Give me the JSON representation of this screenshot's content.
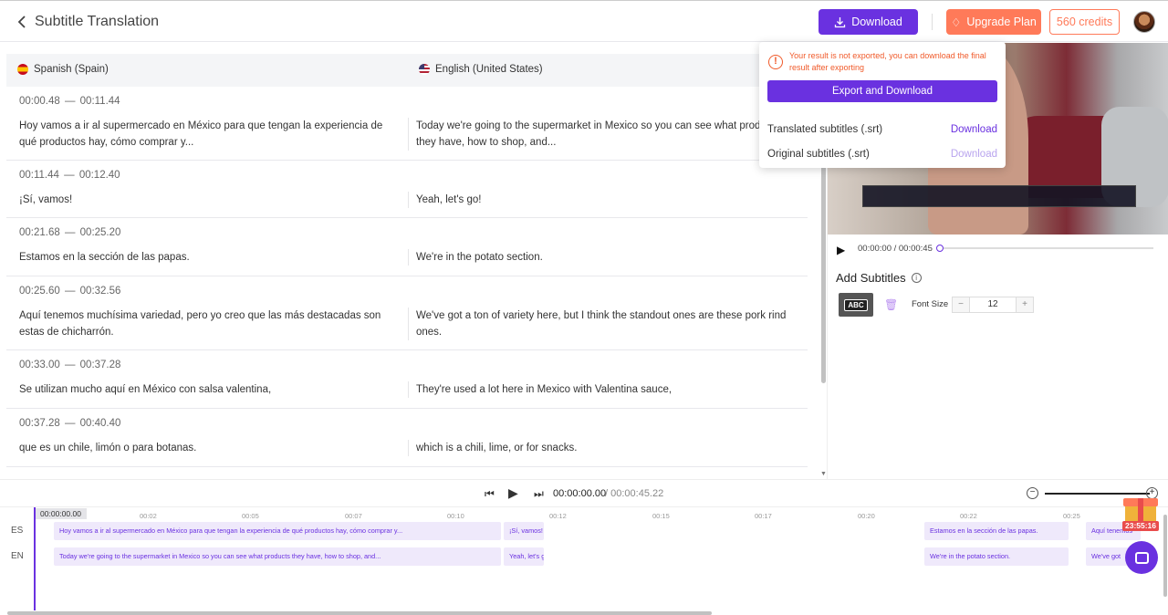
{
  "header": {
    "title": "Subtitle Translation",
    "download_label": "Download",
    "upgrade_label": "Upgrade Plan",
    "credits_label": "560 credits"
  },
  "languages": {
    "source": "Spanish (Spain)",
    "target": "English (United States)"
  },
  "segments": [
    {
      "start": "00:00.48",
      "end": "00:11.44",
      "es": "Hoy vamos a ir al supermercado en México para que tengan la experiencia de qué productos hay, cómo comprar y...",
      "en": "Today we're going to the supermarket in Mexico so you can see what products they have, how to shop, and..."
    },
    {
      "start": "00:11.44",
      "end": "00:12.40",
      "es": "¡Sí, vamos!",
      "en": "Yeah, let's go!"
    },
    {
      "start": "00:21.68",
      "end": "00:25.20",
      "es": "Estamos en la sección de las papas.",
      "en": "We're in the potato section."
    },
    {
      "start": "00:25.60",
      "end": "00:32.56",
      "es": "Aquí tenemos muchísima variedad, pero yo creo que las más destacadas son estas de chicharrón.",
      "en": "We've got a ton of variety here, but I think the standout ones are these pork rind ones."
    },
    {
      "start": "00:33.00",
      "end": "00:37.28",
      "es": "Se utilizan mucho aquí en México con salsa valentina,",
      "en": "They're used a lot here in Mexico with Valentina sauce,"
    },
    {
      "start": "00:37.28",
      "end": "00:40.40",
      "es": "que es un chile, limón o para botanas.",
      "en": "which is a chili, lime, or for snacks."
    }
  ],
  "popup": {
    "warning": "Your result is not exported, you can download the final result after exporting",
    "export_label": "Export and Download",
    "rows": [
      {
        "label": "Translated subtitles (.srt)",
        "action": "Download"
      },
      {
        "label": "Original subtitles (.srt)",
        "action": "Download"
      }
    ]
  },
  "player": {
    "time": "00:00:00 / 00:00:45",
    "progress": 0
  },
  "panel": {
    "add_subtitles": "Add Subtitles",
    "style_icon": "ABC",
    "font_size_label": "Font Size",
    "font_size": "12",
    "minus": "−",
    "plus": "+"
  },
  "transport": {
    "current": "00:00:00.00",
    "total": "/ 00:00:45.22"
  },
  "timeline": {
    "playhead": "00:00:00.00",
    "ticks": [
      "00:02",
      "00:05",
      "00:07",
      "00:10",
      "00:12",
      "00:15",
      "00:17",
      "00:20",
      "00:22",
      "00:25"
    ],
    "tracks": [
      "ES",
      "EN"
    ],
    "es_clips": [
      "Hoy vamos a ir al supermercado en México para que tengan la experiencia de qué productos hay, cómo comprar y...",
      "¡Sí, vamos!",
      "Estamos en la sección de las papas.",
      "Aquí tenemos"
    ],
    "en_clips": [
      "Today we're going to the supermarket in Mexico so you can see what products they have, how to shop, and...",
      "Yeah, let's go!",
      "We're in the potato section.",
      "We've got"
    ]
  },
  "gift_timer": "23:55:16",
  "colors": {
    "accent": "#6a31e0",
    "orange": "#ff7a59",
    "warning": "#f05a2a"
  }
}
